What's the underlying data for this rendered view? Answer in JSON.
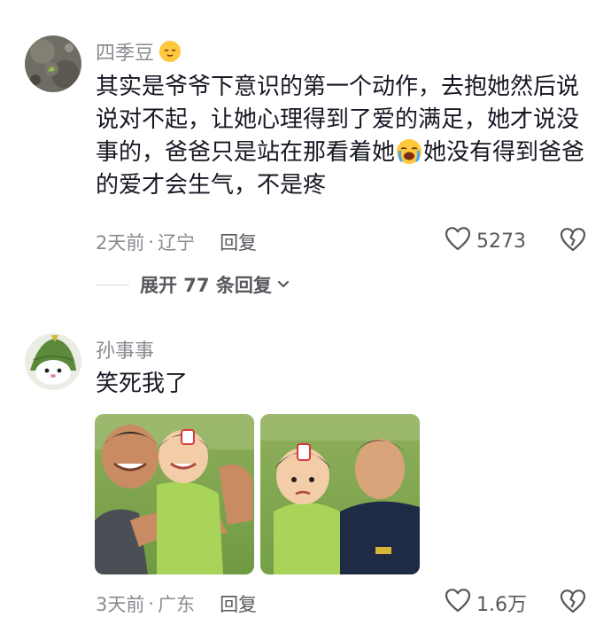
{
  "comments": [
    {
      "username": "四季豆",
      "text_part1": "其实是爷爷下意识的第一个动作，去抱她然后说说对不起，让她心理得到了爱的满足，她才说没事的，爸爸只是站在那看着她",
      "text_part2": "她没有得到爸爸的爱才会生气，不是疼",
      "time": "2天前",
      "location": "辽宁",
      "reply_label": "回复",
      "likes": "5273",
      "expand_label": "展开 77 条回复"
    },
    {
      "username": "孙事事",
      "text": "笑死我了",
      "time": "3天前",
      "location": "广东",
      "reply_label": "回复",
      "likes": "1.6万"
    }
  ],
  "separator": "·",
  "icons": {
    "like": "heart-outline-icon",
    "dislike": "broken-heart-icon",
    "expand": "chevron-down-icon",
    "emoji_username": "relieved-face-emoji",
    "emoji_inline": "crying-face-emoji"
  },
  "colors": {
    "text": "#161823",
    "secondary": "#8a8b91",
    "action": "#57585e"
  }
}
